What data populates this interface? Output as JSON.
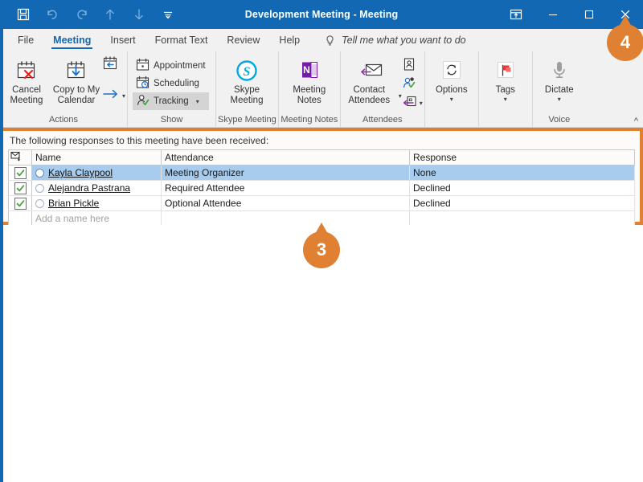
{
  "window": {
    "title": "Development Meeting - Meeting",
    "accent_blue": "#1268b3",
    "callout_orange": "#e08033",
    "selection_blue": "#a8cced",
    "quick_access": [
      {
        "name": "save-icon",
        "label": "Save"
      },
      {
        "name": "undo-icon",
        "label": "Undo"
      },
      {
        "name": "redo-icon",
        "label": "Redo"
      },
      {
        "name": "previous-item-icon",
        "label": "Previous Item"
      },
      {
        "name": "next-item-icon",
        "label": "Next Item"
      },
      {
        "name": "customize-quick-access-toolbar-icon",
        "label": "Customize Quick Access Toolbar"
      }
    ],
    "controls": {
      "ribbon_display_options": "Ribbon Display Options",
      "minimize": "Minimize",
      "maximize": "Maximize",
      "close": "Close"
    }
  },
  "tabs": [
    {
      "label": "File",
      "active": false
    },
    {
      "label": "Meeting",
      "active": true
    },
    {
      "label": "Insert",
      "active": false
    },
    {
      "label": "Format Text",
      "active": false
    },
    {
      "label": "Review",
      "active": false
    },
    {
      "label": "Help",
      "active": false
    }
  ],
  "tell_me": {
    "label": "Tell me what you want to do",
    "icon": "lightbulb-icon"
  },
  "ribbon": {
    "groups": [
      {
        "label": "Actions",
        "buttons": [
          {
            "label": "Cancel Meeting",
            "icon": "calendar-cancel-icon"
          },
          {
            "label": "Copy to My Calendar",
            "icon": "calendar-copy-icon"
          },
          {
            "label": "Calendar Forward",
            "icon": "calendar-forward-icon"
          },
          {
            "label": "Forward",
            "icon": "forward-arrow-icon",
            "has_caret": true
          }
        ]
      },
      {
        "label": "Show",
        "buttons": [
          {
            "label": "Appointment",
            "icon": "appointment-icon"
          },
          {
            "label": "Scheduling",
            "icon": "scheduling-icon"
          },
          {
            "label": "Tracking",
            "icon": "tracking-icon",
            "has_caret": true,
            "selected": true
          }
        ]
      },
      {
        "label": "Skype Meeting",
        "buttons": [
          {
            "label": "Skype Meeting",
            "icon": "skype-icon"
          }
        ]
      },
      {
        "label": "Meeting Notes",
        "buttons": [
          {
            "label": "Meeting Notes",
            "icon": "onenote-icon"
          }
        ]
      },
      {
        "label": "Attendees",
        "buttons": [
          {
            "label": "Contact Attendees",
            "icon": "contact-attendees-icon",
            "has_caret": true
          },
          {
            "label": "Address Book",
            "icon": "address-card-icon"
          },
          {
            "label": "Check Names",
            "icon": "check-names-icon"
          },
          {
            "label": "Response Options",
            "icon": "response-options-icon",
            "has_caret": true
          }
        ]
      },
      {
        "label": "",
        "buttons": [
          {
            "label": "Options",
            "icon": "options-refresh-icon",
            "has_caret": true
          }
        ]
      },
      {
        "label": "",
        "buttons": [
          {
            "label": "Tags",
            "icon": "tags-flag-icon",
            "has_caret": true
          }
        ]
      },
      {
        "label": "Voice",
        "buttons": [
          {
            "label": "Dictate",
            "icon": "microphone-icon",
            "has_caret": true
          }
        ]
      }
    ],
    "collapse_label": "Collapse the Ribbon"
  },
  "tracking": {
    "note": "The following responses to this meeting have been received:",
    "columns": [
      "",
      "Name",
      "Attendance",
      "Response"
    ],
    "header_icon": "envelope-sort-icon",
    "rows": [
      {
        "checked": true,
        "name": "Kayla Claypool",
        "attendance": "Meeting Organizer",
        "response": "None",
        "selected": true
      },
      {
        "checked": true,
        "name": "Alejandra Pastrana",
        "attendance": "Required Attendee",
        "response": "Declined",
        "selected": false
      },
      {
        "checked": true,
        "name": "Brian Pickle",
        "attendance": "Optional Attendee",
        "response": "Declined",
        "selected": false
      }
    ],
    "new_row_placeholder": "Add a name here"
  },
  "callouts": [
    {
      "number": "3",
      "target": "tracking-panel"
    },
    {
      "number": "4",
      "target": "close-button"
    }
  ]
}
